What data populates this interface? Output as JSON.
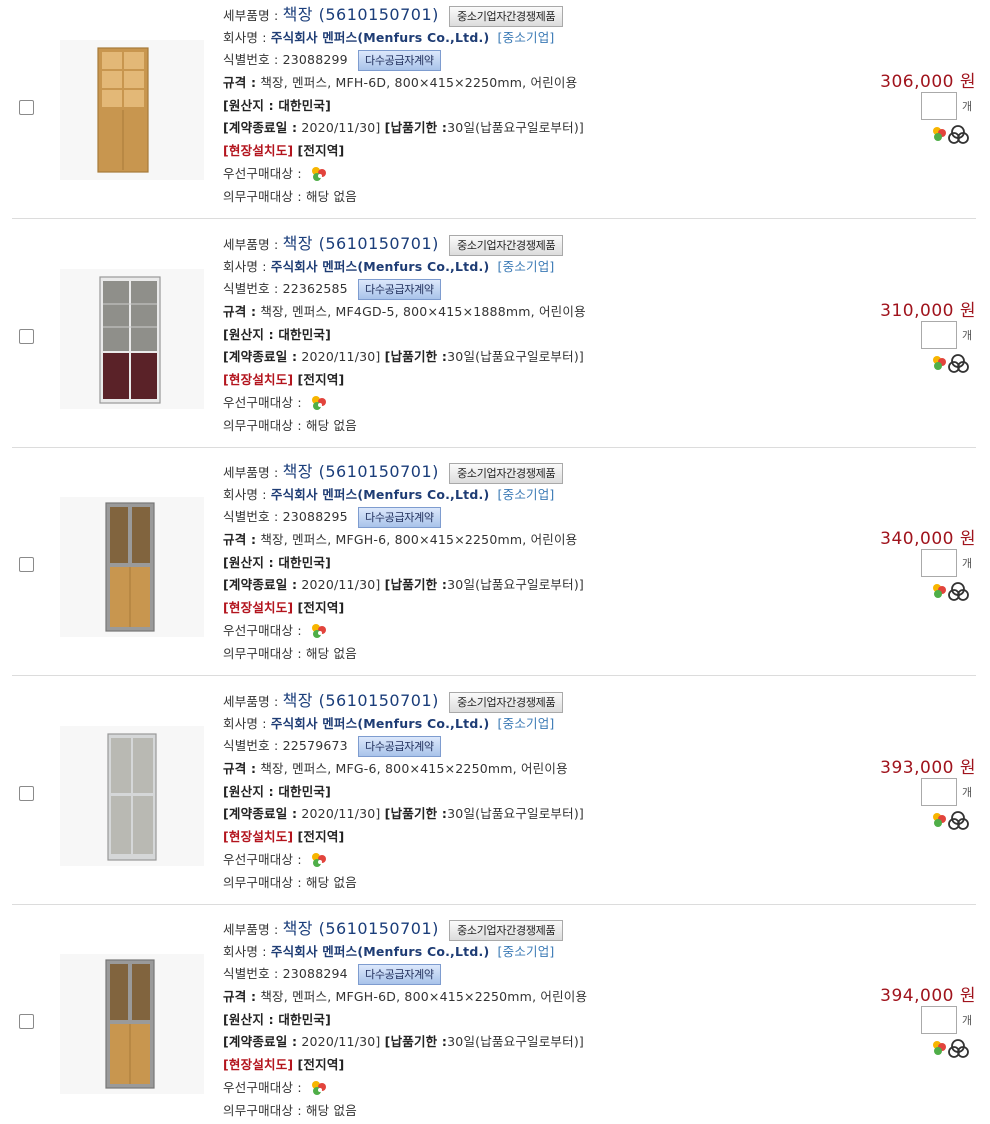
{
  "labels": {
    "item_name": "세부품명 :",
    "company": "회사명 :",
    "id_no": "식별번호 :",
    "spec": "규격 :",
    "origin": "[원산지 : 대한민국]",
    "contract_end": "[계약종료일 :",
    "delivery": "[납품기한 :",
    "install": "[현장설치도]",
    "region": "[전지역]",
    "priority": "우선구매대상 :",
    "mandatory": "의무구매대상 :"
  },
  "products": [
    {
      "name": "책장 (5610150701)",
      "competition_badge": "중소기업자간경쟁제품",
      "company": "주식회사 멘퍼스(Menfurs Co.,Ltd.)",
      "company_type": "[중소기업]",
      "id": "23088299",
      "supplier_badge": "다수공급자계약",
      "spec": "책장, 멘퍼스, MFH-6D, 800×415×2250mm, 어린이용",
      "contract_end": "2020/11/30]",
      "delivery": "30일(납품요구일로부터)]",
      "mandatory": "해당 없음",
      "price": "306,000 원",
      "unit": "개",
      "image": "bookcase-open-top-wood-icon"
    },
    {
      "name": "책장 (5610150701)",
      "competition_badge": "중소기업자간경쟁제품",
      "company": "주식회사 멘퍼스(Menfurs Co.,Ltd.)",
      "company_type": "[중소기업]",
      "id": "22362585",
      "supplier_badge": "다수공급자계약",
      "spec": "책장, 멘퍼스, MF4GD-5, 800×415×1888mm, 어린이용",
      "contract_end": "2020/11/30]",
      "delivery": "30일(납품요구일로부터)]",
      "mandatory": "해당 없음",
      "price": "310,000 원",
      "unit": "개",
      "image": "bookcase-glass-dark-wood-icon"
    },
    {
      "name": "책장 (5610150701)",
      "competition_badge": "중소기업자간경쟁제품",
      "company": "주식회사 멘퍼스(Menfurs Co.,Ltd.)",
      "company_type": "[중소기업]",
      "id": "23088295",
      "supplier_badge": "다수공급자계약",
      "spec": "책장, 멘퍼스, MFGH-6, 800×415×2250mm, 어린이용",
      "contract_end": "2020/11/30]",
      "delivery": "30일(납품요구일로부터)]",
      "mandatory": "해당 없음",
      "price": "340,000 원",
      "unit": "개",
      "image": "bookcase-glass-grey-wood-icon"
    },
    {
      "name": "책장 (5610150701)",
      "competition_badge": "중소기업자간경쟁제품",
      "company": "주식회사 멘퍼스(Menfurs Co.,Ltd.)",
      "company_type": "[중소기업]",
      "id": "22579673",
      "supplier_badge": "다수공급자계약",
      "spec": "책장, 멘퍼스, MFG-6, 800×415×2250mm, 어린이용",
      "contract_end": "2020/11/30]",
      "delivery": "30일(납품요구일로부터)]",
      "mandatory": "해당 없음",
      "price": "393,000 원",
      "unit": "개",
      "image": "bookcase-frosted-glass-icon"
    },
    {
      "name": "책장 (5610150701)",
      "competition_badge": "중소기업자간경쟁제품",
      "company": "주식회사 멘퍼스(Menfurs Co.,Ltd.)",
      "company_type": "[중소기업]",
      "id": "23088294",
      "supplier_badge": "다수공급자계약",
      "spec": "책장, 멘퍼스, MFGH-6D, 800×415×2250mm, 어린이용",
      "contract_end": "2020/11/30]",
      "delivery": "30일(납품요구일로부터)]",
      "mandatory": "해당 없음",
      "price": "394,000 원",
      "unit": "개",
      "image": "bookcase-glass-grey-wood-icon"
    }
  ],
  "colors": {
    "price": "#a0141d",
    "company": "#1e3c74",
    "sme": "#3b7ab5",
    "install": "#b3141d",
    "blue_badge": "#a9c3ea"
  }
}
